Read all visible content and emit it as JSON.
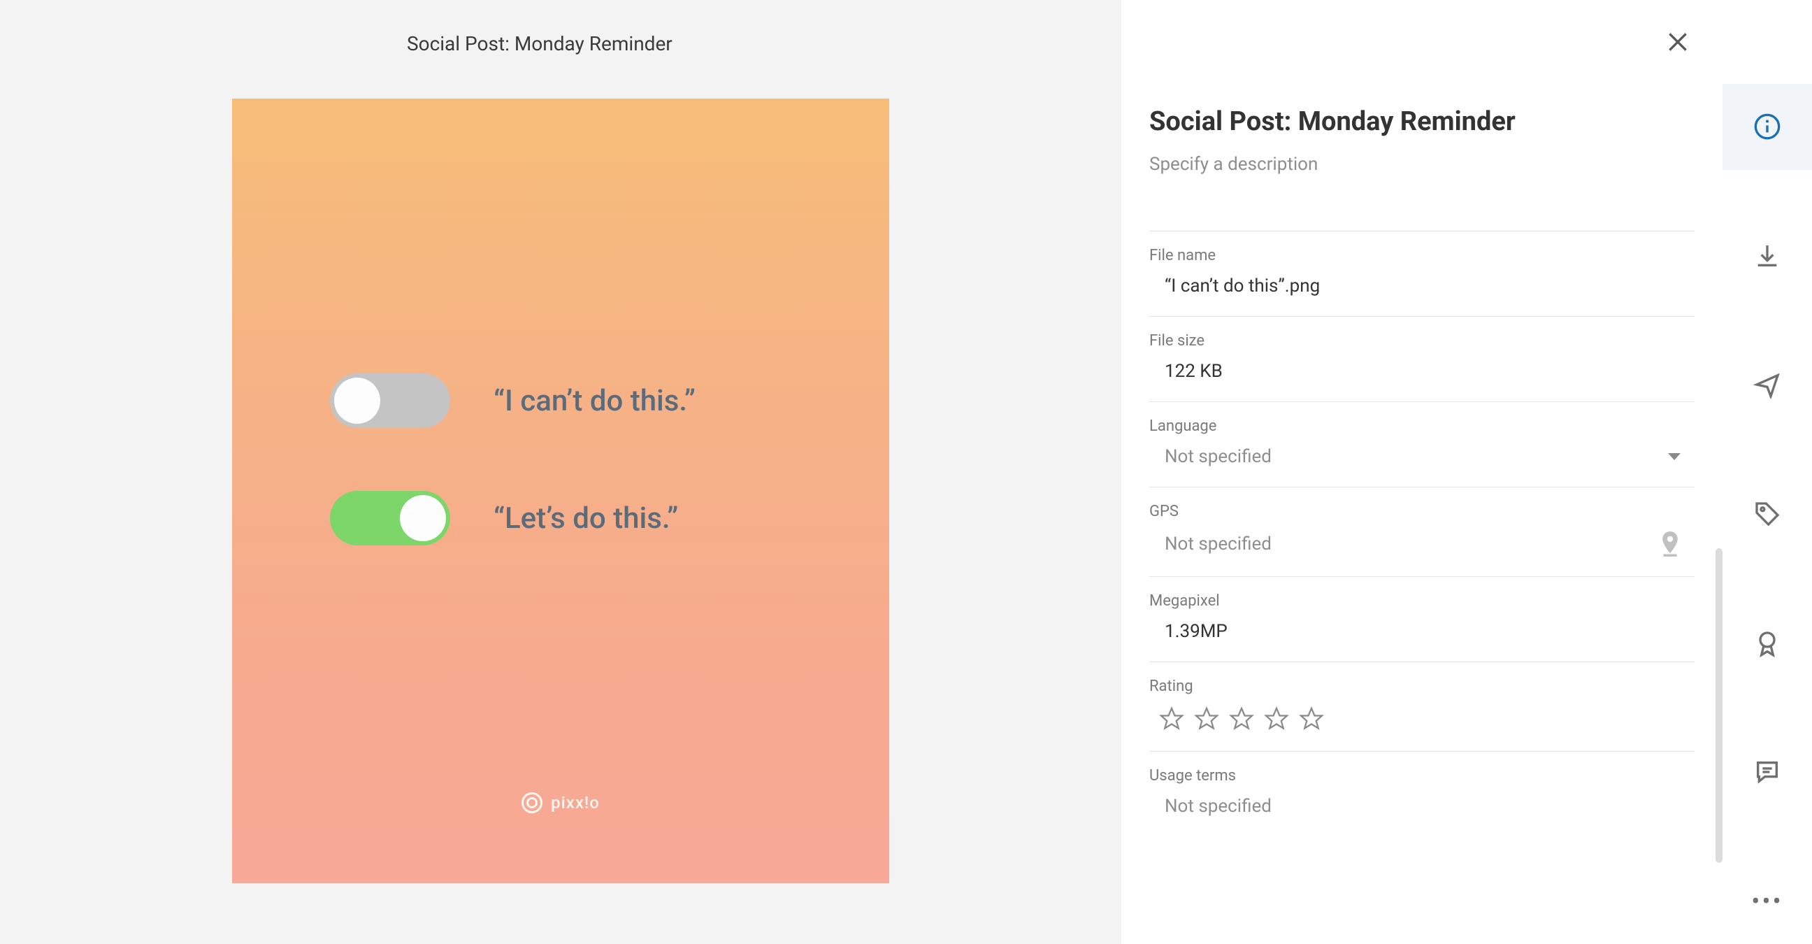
{
  "preview": {
    "title": "Social Post: Monday Reminder",
    "poster": {
      "line1": "“I can’t do this.”",
      "line2": "“Let’s do this.”",
      "brand": "pixx!o"
    }
  },
  "detail": {
    "title": "Social Post: Monday Reminder",
    "description_placeholder": "Specify a description",
    "fields": {
      "file_name": {
        "label": "File name",
        "value": "“I can’t do this”.png"
      },
      "file_size": {
        "label": "File size",
        "value": "122 KB"
      },
      "language": {
        "label": "Language",
        "value": "Not specified"
      },
      "gps": {
        "label": "GPS",
        "value": "Not specified"
      },
      "megapixel": {
        "label": "Megapixel",
        "value": "1.39MP"
      },
      "rating": {
        "label": "Rating",
        "value": 0,
        "max": 5
      },
      "usage": {
        "label": "Usage terms",
        "value": "Not specified"
      }
    }
  },
  "rail": {
    "info": "info-icon",
    "download": "download-icon",
    "share": "share-icon",
    "tag": "tag-icon",
    "award": "award-icon",
    "comment": "comment-icon",
    "more": "more-icon"
  }
}
